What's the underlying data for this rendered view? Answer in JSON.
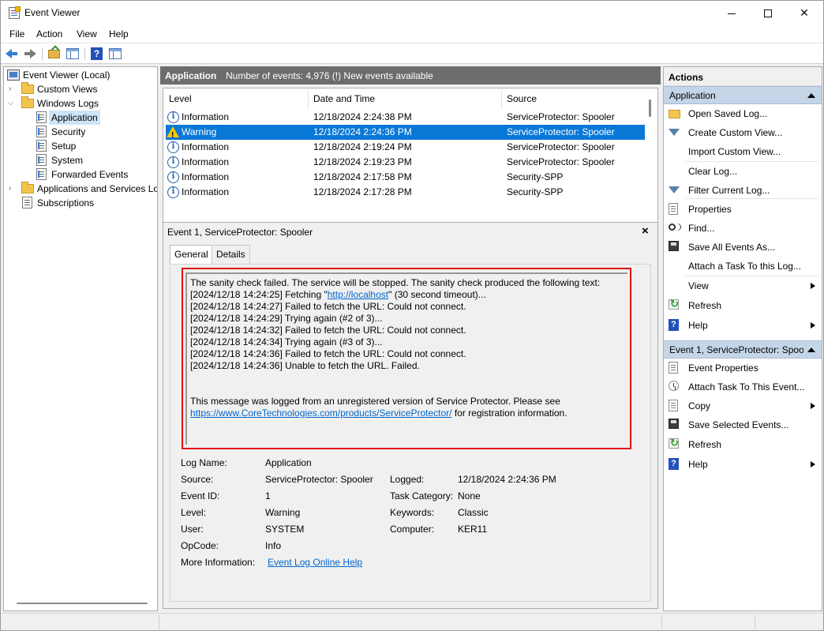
{
  "window": {
    "title": "Event Viewer"
  },
  "menu": [
    "File",
    "Action",
    "View",
    "Help"
  ],
  "tree": {
    "root": "Event Viewer (Local)",
    "custom_views": "Custom Views",
    "windows_logs": "Windows Logs",
    "logs": [
      "Application",
      "Security",
      "Setup",
      "System",
      "Forwarded Events"
    ],
    "apps_services": "Applications and Services Lo",
    "subscriptions": "Subscriptions",
    "selected": "Application"
  },
  "header": {
    "name": "Application",
    "info": "Number of events: 4,976 (!) New events available"
  },
  "events": {
    "columns": [
      "Level",
      "Date and Time",
      "Source"
    ],
    "rows": [
      {
        "level": "Information",
        "date": "12/18/2024 2:24:38 PM",
        "source": "ServiceProtector: Spooler",
        "icon": "info-icon"
      },
      {
        "level": "Warning",
        "date": "12/18/2024 2:24:36 PM",
        "source": "ServiceProtector: Spooler",
        "icon": "warning-icon"
      },
      {
        "level": "Information",
        "date": "12/18/2024 2:19:24 PM",
        "source": "ServiceProtector: Spooler",
        "icon": "info-icon"
      },
      {
        "level": "Information",
        "date": "12/18/2024 2:19:23 PM",
        "source": "ServiceProtector: Spooler",
        "icon": "info-icon"
      },
      {
        "level": "Information",
        "date": "12/18/2024 2:17:58 PM",
        "source": "Security-SPP",
        "icon": "info-icon"
      },
      {
        "level": "Information",
        "date": "12/18/2024 2:17:28 PM",
        "source": "Security-SPP",
        "icon": "info-icon"
      }
    ],
    "selected_index": 1
  },
  "detail": {
    "title": "Event 1, ServiceProtector: Spooler",
    "tabs": [
      "General",
      "Details"
    ],
    "active_tab": "General",
    "message": {
      "line1": "The sanity check failed. The service will be stopped. The sanity check produced the following text:",
      "line2_pre": "[2024/12/18 14:24:25] Fetching \"",
      "line2_link": "http://localhost",
      "line2_post": "\" (30 second timeout)...",
      "lines": [
        "[2024/12/18 14:24:27] Failed to fetch the URL: Could not connect.",
        "[2024/12/18 14:24:29] Trying again (#2 of 3)...",
        "[2024/12/18 14:24:32] Failed to fetch the URL: Could not connect.",
        "[2024/12/18 14:24:34] Trying again (#3 of 3)...",
        "[2024/12/18 14:24:36] Failed to fetch the URL: Could not connect.",
        "[2024/12/18 14:24:36] Unable to fetch the URL. Failed."
      ],
      "footer1": "This message was logged from an unregistered version of Service Protector. Please see",
      "footer_link": "https://www.CoreTechnologies.com/products/ServiceProtector/",
      "footer_post": " for registration information."
    },
    "props": {
      "log_name_label": "Log Name:",
      "log_name": "Application",
      "source_label": "Source:",
      "source": "ServiceProtector: Spooler",
      "logged_label": "Logged:",
      "logged": "12/18/2024 2:24:36 PM",
      "event_id_label": "Event ID:",
      "event_id": "1",
      "task_cat_label": "Task Category:",
      "task_cat": "None",
      "level_label": "Level:",
      "level": "Warning",
      "keywords_label": "Keywords:",
      "keywords": "Classic",
      "user_label": "User:",
      "user": "SYSTEM",
      "computer_label": "Computer:",
      "computer": "KER11",
      "opcode_label": "OpCode:",
      "opcode": "Info",
      "more_info_label": "More Information:",
      "more_info_link": "Event Log Online Help"
    }
  },
  "actions": {
    "title": "Actions",
    "section1": "Application",
    "section1_items": [
      "Open Saved Log...",
      "Create Custom View...",
      "Import Custom View...",
      "Clear Log...",
      "Filter Current Log...",
      "Properties",
      "Find...",
      "Save All Events As...",
      "Attach a Task To this Log...",
      "View",
      "Refresh",
      "Help"
    ],
    "section2": "Event 1, ServiceProtector: Spoo...",
    "section2_items": [
      "Event Properties",
      "Attach Task To This Event...",
      "Copy",
      "Save Selected Events...",
      "Refresh",
      "Help"
    ]
  }
}
